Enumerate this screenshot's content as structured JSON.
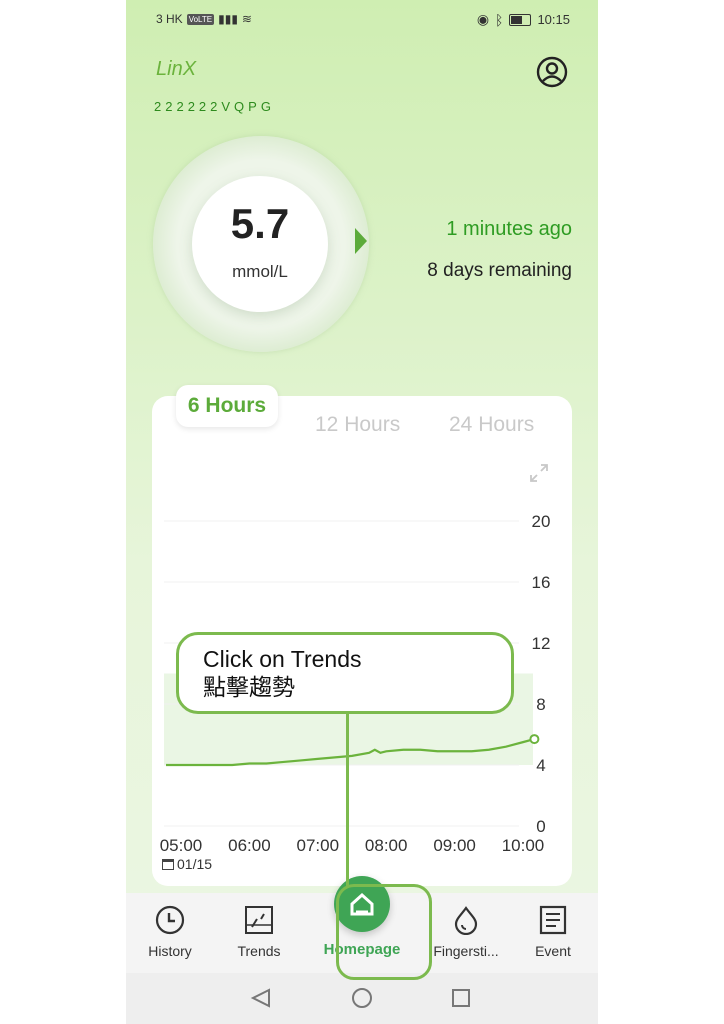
{
  "status_bar": {
    "carrier": "3 HK",
    "volte": "VoLTE",
    "time": "10:15"
  },
  "header": {
    "logo": "LinX",
    "serial": "222222VQPG"
  },
  "glucose": {
    "value": "5.7",
    "unit": "mmol/L",
    "updated": "1 minutes ago",
    "sensor_remaining": "8 days remaining"
  },
  "tabs": [
    {
      "label": "6 Hours",
      "active": true
    },
    {
      "label": "12 Hours",
      "active": false
    },
    {
      "label": "24 Hours",
      "active": false
    }
  ],
  "chart_data": {
    "type": "line",
    "x": [
      "05:00",
      "06:00",
      "07:00",
      "08:00",
      "09:00",
      "10:00"
    ],
    "x_minutes": [
      0,
      60,
      120,
      180,
      240,
      300
    ],
    "y_ticks": [
      "20",
      "16",
      "12",
      "8",
      "4",
      "0"
    ],
    "ylim": [
      0,
      20
    ],
    "target_range": [
      4,
      10
    ],
    "series": [
      {
        "values_x_min": [
          0,
          15,
          30,
          45,
          60,
          75,
          90,
          105,
          120,
          135,
          150,
          165,
          170,
          175,
          180,
          195,
          210,
          225,
          240,
          255,
          270,
          285,
          300,
          310
        ],
        "values_y": [
          4.0,
          4.0,
          4.0,
          4.0,
          4.1,
          4.1,
          4.2,
          4.3,
          4.4,
          4.5,
          4.6,
          4.8,
          5.0,
          4.8,
          4.9,
          5.0,
          5.0,
          4.9,
          4.9,
          4.9,
          5.0,
          5.2,
          5.5,
          5.7
        ]
      }
    ],
    "grid": true,
    "date_label": "01/15"
  },
  "callout": {
    "line1": "Click on Trends",
    "line2": "點擊趨勢"
  },
  "bottom_nav": [
    {
      "label": "History",
      "icon": "history-icon"
    },
    {
      "label": "Trends",
      "icon": "trends-icon"
    },
    {
      "label": "Homepage",
      "icon": "home-icon"
    },
    {
      "label": "Fingersti...",
      "icon": "fingerstick-icon"
    },
    {
      "label": "Event",
      "icon": "event-icon"
    }
  ],
  "colors": {
    "accent": "#3fa555",
    "chart_line": "#6bb33c",
    "range_band": "#eaf6e4",
    "callout_border": "#7cba4e"
  }
}
